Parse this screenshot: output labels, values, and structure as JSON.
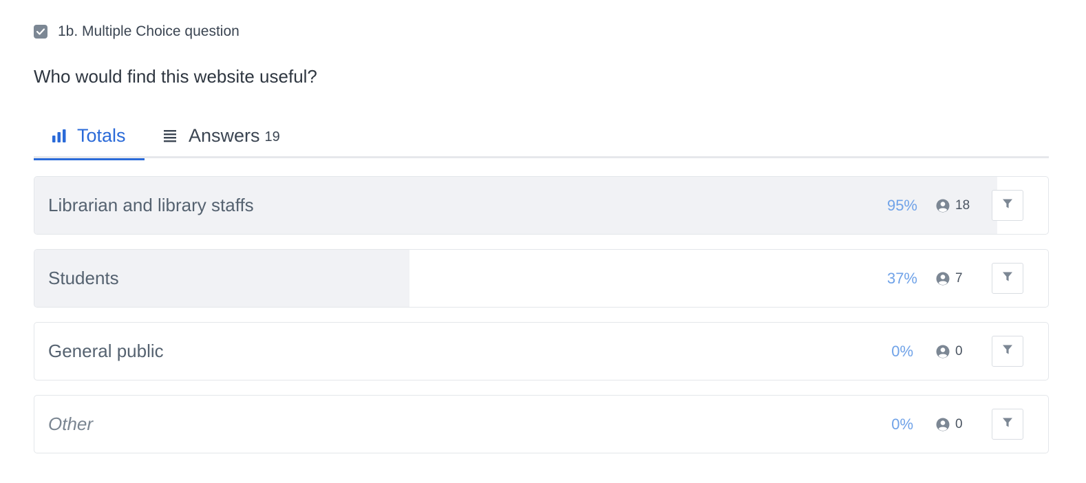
{
  "question": {
    "type_label": "1b. Multiple Choice question",
    "title": "Who would find this website useful?"
  },
  "tabs": {
    "totals_label": "Totals",
    "answers_label": "Answers",
    "answers_count": "19"
  },
  "rows": [
    {
      "label": "Librarian and library staffs",
      "percent_text": "95%",
      "percent": 0.95,
      "count": "18",
      "italic": false
    },
    {
      "label": "Students",
      "percent_text": "37%",
      "percent": 0.37,
      "count": "7",
      "italic": false
    },
    {
      "label": "General public",
      "percent_text": "0%",
      "percent": 0,
      "count": "0",
      "italic": false
    },
    {
      "label": "Other",
      "percent_text": "0%",
      "percent": 0,
      "count": "0",
      "italic": true
    }
  ],
  "colors": {
    "accent": "#2a6ad8",
    "percent": "#6fa2e8",
    "bar_fill": "#f1f2f5"
  },
  "icons": [
    "checkbox-checked-icon",
    "bar-chart-icon",
    "list-icon",
    "user-circle-icon",
    "filter-icon"
  ]
}
